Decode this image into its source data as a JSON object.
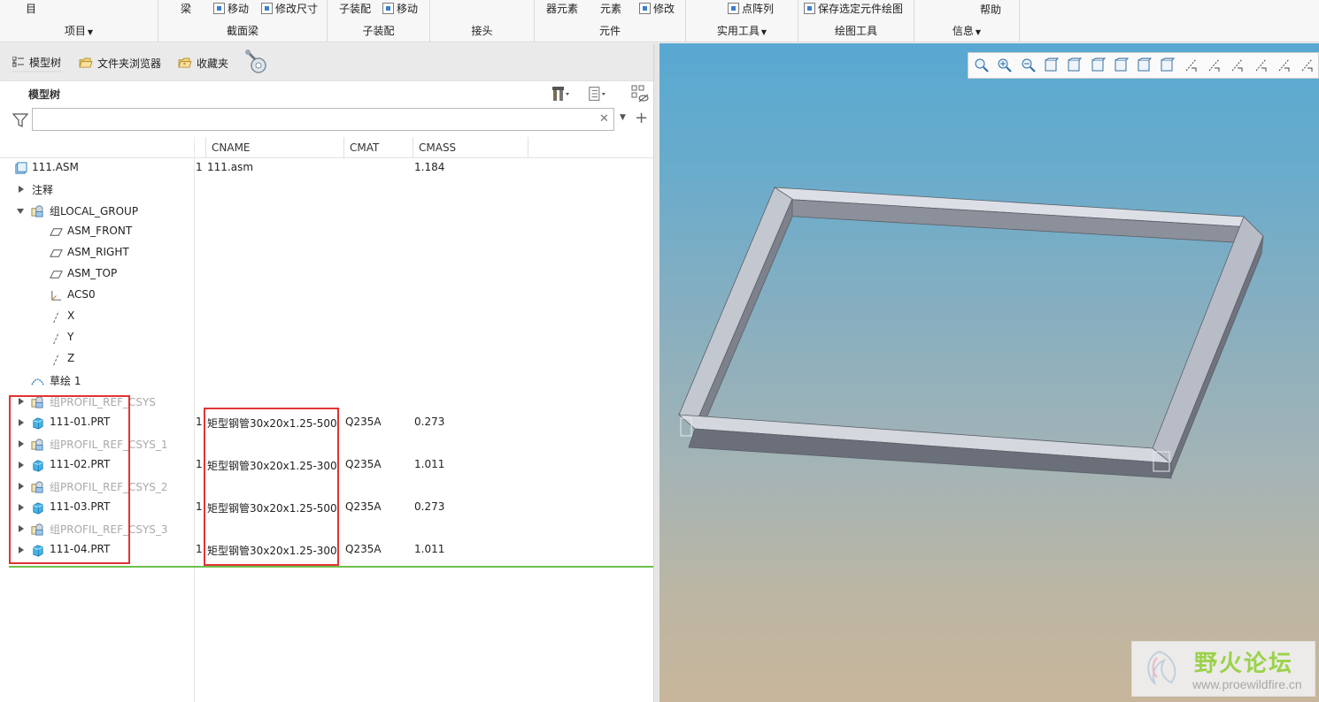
{
  "ribbon": {
    "groups": [
      {
        "label": "项目",
        "dropdown": true,
        "buttons": [
          "目"
        ]
      },
      {
        "label": "截面梁",
        "dropdown": false,
        "buttons": [
          "梁",
          "移动",
          "修改尺寸"
        ]
      },
      {
        "label": "子装配",
        "dropdown": false,
        "buttons": [
          "子装配",
          "移动"
        ]
      },
      {
        "label": "接头",
        "dropdown": false,
        "buttons": []
      },
      {
        "label": "元件",
        "dropdown": false,
        "buttons": [
          "器元素",
          "元素",
          "修改"
        ]
      },
      {
        "label": "实用工具",
        "dropdown": true,
        "buttons": [
          "点阵列"
        ]
      },
      {
        "label": "绘图工具",
        "dropdown": false,
        "buttons": [
          "保存选定元件绘图"
        ]
      },
      {
        "label": "信息",
        "dropdown": true,
        "buttons": [
          "帮助"
        ]
      }
    ]
  },
  "panel_tabs": [
    "模型树",
    "文件夹浏览器",
    "收藏夹"
  ],
  "tree_title": "模型树",
  "search": {
    "value": "",
    "placeholder": ""
  },
  "columns": [
    "CNAME",
    "CMAT",
    "CMASS"
  ],
  "tree": [
    {
      "label": "111.ASM",
      "icon": "assembly-icon",
      "expander": "none",
      "indent": 0,
      "dim": false,
      "c1": "1",
      "cname": "111.asm",
      "cmat": "",
      "cmass": "1.184"
    },
    {
      "label": "注释",
      "icon": "none",
      "expander": "right",
      "indent": 0,
      "dim": false,
      "c1": "",
      "cname": "",
      "cmat": "",
      "cmass": ""
    },
    {
      "label": "组LOCAL_GROUP",
      "icon": "group-icon",
      "expander": "down",
      "indent": 0,
      "dim": false,
      "c1": "",
      "cname": "",
      "cmat": "",
      "cmass": ""
    },
    {
      "label": "ASM_FRONT",
      "icon": "datum-plane-icon",
      "expander": "none",
      "indent": 1,
      "dim": false,
      "c1": "",
      "cname": "",
      "cmat": "",
      "cmass": ""
    },
    {
      "label": "ASM_RIGHT",
      "icon": "datum-plane-icon",
      "expander": "none",
      "indent": 1,
      "dim": false,
      "c1": "",
      "cname": "",
      "cmat": "",
      "cmass": ""
    },
    {
      "label": "ASM_TOP",
      "icon": "datum-plane-icon",
      "expander": "none",
      "indent": 1,
      "dim": false,
      "c1": "",
      "cname": "",
      "cmat": "",
      "cmass": ""
    },
    {
      "label": "ACS0",
      "icon": "csys-icon",
      "expander": "none",
      "indent": 1,
      "dim": false,
      "c1": "",
      "cname": "",
      "cmat": "",
      "cmass": ""
    },
    {
      "label": "X",
      "icon": "axis-icon",
      "expander": "none",
      "indent": 1,
      "dim": false,
      "c1": "",
      "cname": "",
      "cmat": "",
      "cmass": ""
    },
    {
      "label": "Y",
      "icon": "axis-icon",
      "expander": "none",
      "indent": 1,
      "dim": false,
      "c1": "",
      "cname": "",
      "cmat": "",
      "cmass": ""
    },
    {
      "label": "Z",
      "icon": "axis-icon",
      "expander": "none",
      "indent": 1,
      "dim": false,
      "c1": "",
      "cname": "",
      "cmat": "",
      "cmass": ""
    },
    {
      "label": "草绘 1",
      "icon": "sketch-icon",
      "expander": "none",
      "indent": 0,
      "dim": false,
      "c1": "",
      "cname": "",
      "cmat": "",
      "cmass": ""
    },
    {
      "label": "组PROFIL_REF_CSYS",
      "icon": "group-icon",
      "expander": "right",
      "indent": 0,
      "dim": true,
      "c1": "",
      "cname": "",
      "cmat": "",
      "cmass": ""
    },
    {
      "label": "111-01.PRT",
      "icon": "part-icon",
      "expander": "right",
      "indent": 0,
      "dim": false,
      "c1": "1",
      "cname": "矩型钢管30x20x1.25-500",
      "cmat": "Q235A",
      "cmass": "0.273"
    },
    {
      "label": "组PROFIL_REF_CSYS_1",
      "icon": "group-icon",
      "expander": "right",
      "indent": 0,
      "dim": true,
      "c1": "",
      "cname": "",
      "cmat": "",
      "cmass": ""
    },
    {
      "label": "111-02.PRT",
      "icon": "part-icon",
      "expander": "right",
      "indent": 0,
      "dim": false,
      "c1": "1",
      "cname": "矩型钢管30x20x1.25-300",
      "cmat": "Q235A",
      "cmass": "1.011"
    },
    {
      "label": "组PROFIL_REF_CSYS_2",
      "icon": "group-icon",
      "expander": "right",
      "indent": 0,
      "dim": true,
      "c1": "",
      "cname": "",
      "cmat": "",
      "cmass": ""
    },
    {
      "label": "111-03.PRT",
      "icon": "part-icon",
      "expander": "right",
      "indent": 0,
      "dim": false,
      "c1": "1",
      "cname": "矩型钢管30x20x1.25-500",
      "cmat": "Q235A",
      "cmass": "0.273"
    },
    {
      "label": "组PROFIL_REF_CSYS_3",
      "icon": "group-icon",
      "expander": "right",
      "indent": 0,
      "dim": true,
      "c1": "",
      "cname": "",
      "cmat": "",
      "cmass": ""
    },
    {
      "label": "111-04.PRT",
      "icon": "part-icon",
      "expander": "right",
      "indent": 0,
      "dim": false,
      "c1": "1",
      "cname": "矩型钢管30x20x1.25-300",
      "cmat": "Q235A",
      "cmass": "1.011"
    }
  ],
  "view_tools": [
    "zoom-fit-icon",
    "zoom-in-icon",
    "zoom-out-icon",
    "repaint-icon",
    "perspective-icon",
    "saved-views-icon",
    "view-manager-icon",
    "display-style-icon",
    "section-icon",
    "datum-display-icon",
    "plane-display-icon",
    "axis-display-icon",
    "point-display-icon",
    "csys-display-icon",
    "annotation-display-icon"
  ],
  "watermark": {
    "title": "野火论坛",
    "url": "www.proewildfire.cn"
  },
  "colors": {
    "highlight": "#e23333",
    "separator": "#6cc04a",
    "part": "#3aa6dd",
    "assembly": "#4a9bd6"
  }
}
